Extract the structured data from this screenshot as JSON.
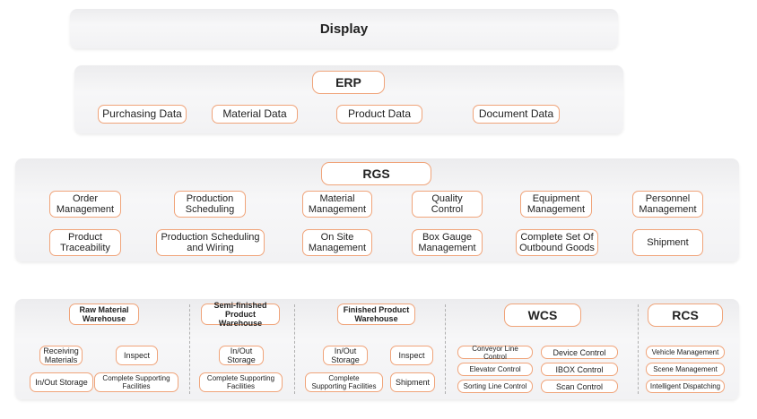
{
  "display": {
    "title": "Display"
  },
  "erp": {
    "title": "ERP",
    "items": [
      "Purchasing Data",
      "Material Data",
      "Product Data",
      "Document Data"
    ]
  },
  "rgs": {
    "title": "RGS",
    "row1": [
      "Order\nManagement",
      "Production\nScheduling",
      "Material\nManagement",
      "Quality\nControl",
      "Equipment\nManagement",
      "Personnel\nManagement"
    ],
    "row2": [
      "Product\nTraceability",
      "Production Scheduling\nand Wiring",
      "On Site\nManagement",
      "Box Gauge\nManagement",
      "Complete Set Of\nOutbound Goods",
      "Shipment"
    ]
  },
  "raw": {
    "title": "Raw Material\nWarehouse",
    "receiving": "Receiving\nMaterials",
    "inspect": "Inspect",
    "storage": "In/Out Storage",
    "facilities": "Complete Supporting\nFacilities"
  },
  "semi": {
    "title": "Semi-finished\nProduct Warehouse",
    "storage": "In/Out\nStorage",
    "facilities": "Complete Supporting\nFacilities"
  },
  "finished": {
    "title": "Finished Product\nWarehouse",
    "storage": "In/Out\nStorage",
    "inspect": "Inspect",
    "facilities": "Complete\nSupporting Facilities",
    "shipment": "Shipment"
  },
  "wcs": {
    "title": "WCS",
    "items": [
      "Conveyor Line Control",
      "Device Control",
      "Elevator Control",
      "IBOX Control",
      "Sorting Line Control",
      "Scan Control"
    ]
  },
  "rcs": {
    "title": "RCS",
    "items": [
      "Vehicle Management",
      "Scene Management",
      "Intelligent Dispatching"
    ]
  }
}
